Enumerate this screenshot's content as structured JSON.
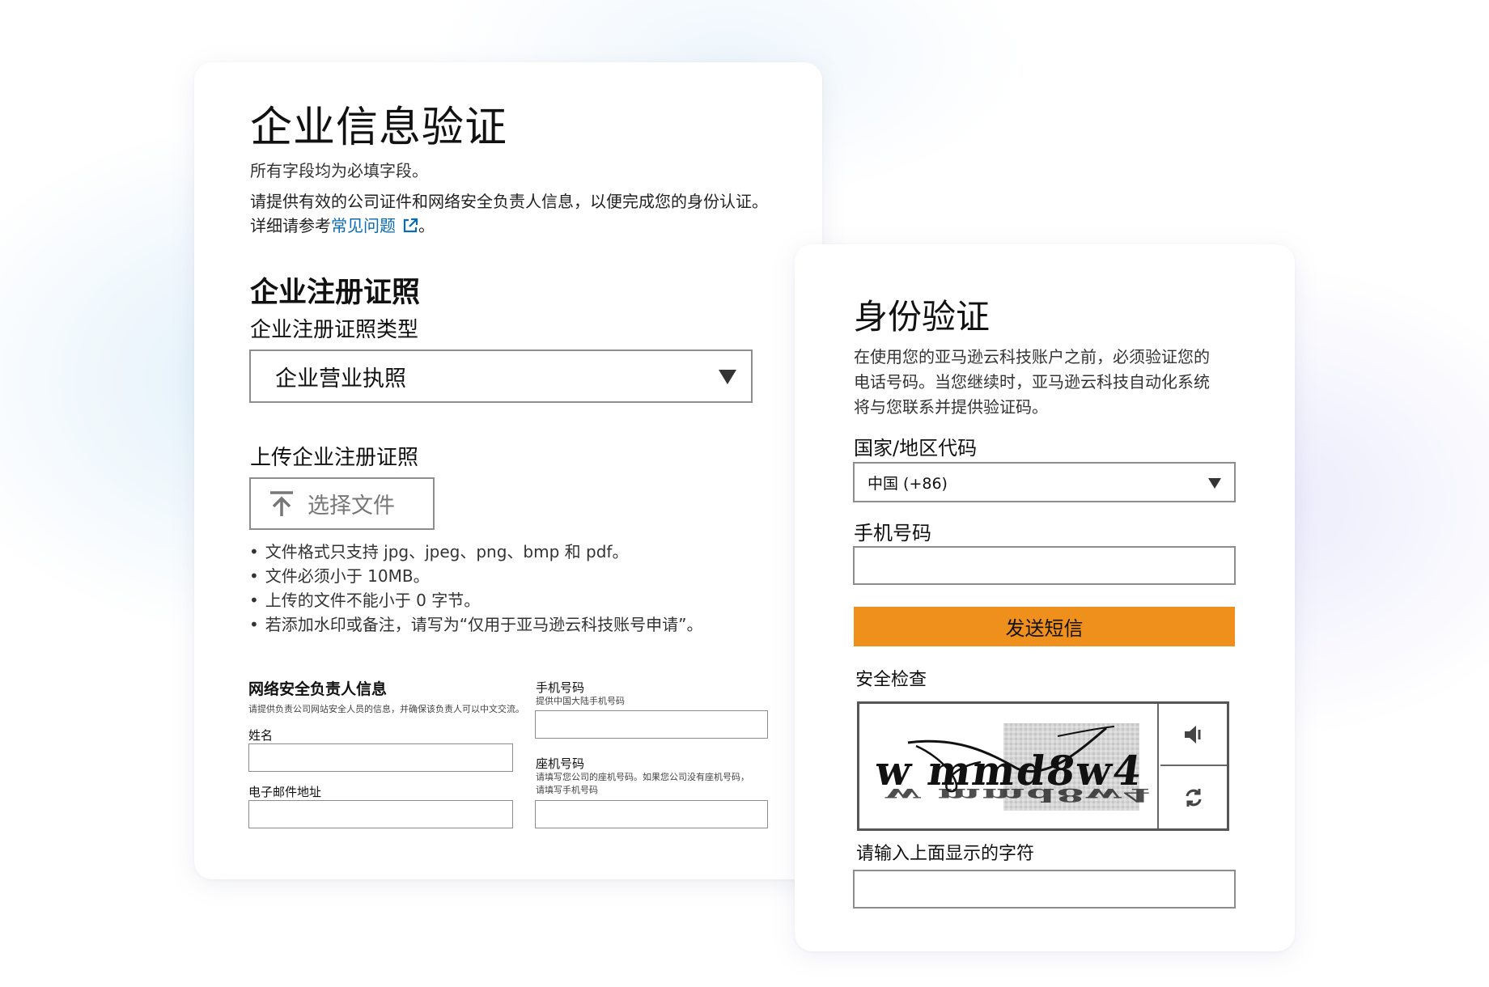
{
  "company_card": {
    "title": "企业信息验证",
    "required_note": "所有字段均为必填字段。",
    "description_line1": "请提供有效的公司证件和网络安全负责人信息，以便完成您的身份认证。",
    "description_line2_prefix": "详细请参考",
    "faq_link": "常见问题",
    "description_line2_suffix": "。",
    "license_section_title": "企业注册证照",
    "license_type_label": "企业注册证照类型",
    "license_type_value": "企业营业执照",
    "upload_label": "上传企业注册证照",
    "upload_button": "选择文件",
    "upload_rules": [
      "文件格式只支持 jpg、jpeg、png、bmp 和 pdf。",
      "文件必须小于 10MB。",
      "上传的文件不能小于 0 字节。",
      "若添加水印或备注，请写为“仅用于亚马逊云科技账号申请”。"
    ],
    "security_contact": {
      "title": "网络安全负责人信息",
      "subtitle": "请提供负责公司网站安全人员的信息，并确保该负责人可以中文交流。",
      "name_label": "姓名",
      "name_value": "",
      "email_label": "电子邮件地址",
      "email_value": "",
      "mobile_label": "手机号码",
      "mobile_hint": "提供中国大陆手机号码",
      "mobile_value": "",
      "landline_label": "座机号码",
      "landline_hint_line1": "请填写您公司的座机号码。如果您公司没有座机号码，",
      "landline_hint_line2": "请填写手机号码",
      "landline_value": ""
    }
  },
  "identity_card": {
    "title": "身份验证",
    "description_lines": [
      "在使用您的亚马逊云科技账户之前，必须验证您的",
      "电话号码。当您继续时，亚马逊云科技自动化系统",
      "将与您联系并提供验证码。"
    ],
    "country_label": "国家/地区代码",
    "country_value": "中国 (+86)",
    "phone_label": "手机号码",
    "phone_value": "",
    "send_sms_button": "发送短信",
    "security_check_label": "安全检查",
    "captcha_image_text": "w mmd8w4",
    "captcha_input_label": "请输入上面显示的字符",
    "captcha_input_value": "",
    "accent_color": "#f0901c",
    "link_color": "#0a6ab4"
  }
}
